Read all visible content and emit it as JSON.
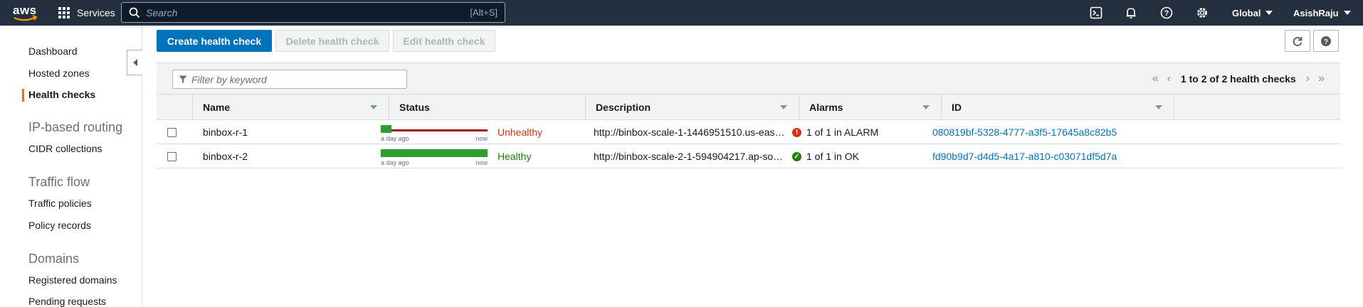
{
  "topnav": {
    "logo_text": "aws",
    "services_label": "Services",
    "search_placeholder": "Search",
    "search_shortcut": "[Alt+S]",
    "region_label": "Global",
    "user_label": "AsishRaju"
  },
  "sidebar": {
    "items": [
      {
        "label": "Dashboard"
      },
      {
        "label": "Hosted zones"
      },
      {
        "label": "Health checks"
      }
    ],
    "sections": [
      {
        "heading": "IP-based routing",
        "items": [
          "CIDR collections"
        ]
      },
      {
        "heading": "Traffic flow",
        "items": [
          "Traffic policies",
          "Policy records"
        ]
      },
      {
        "heading": "Domains",
        "items": [
          "Registered domains",
          "Pending requests"
        ]
      }
    ]
  },
  "toolbar": {
    "create_label": "Create health check",
    "delete_label": "Delete health check",
    "edit_label": "Edit health check"
  },
  "table": {
    "filter_placeholder": "Filter by keyword",
    "pagination_text": "1 to 2 of 2 health checks",
    "columns": [
      "Name",
      "Status",
      "Description",
      "Alarms",
      "ID"
    ],
    "rows": [
      {
        "name": "binbox-r-1",
        "spark_left": "a day ago",
        "spark_right": "now",
        "healthy_fraction": 0.1,
        "status": "Unhealthy",
        "description": "http://binbox-scale-1-1446951510.us-eas…",
        "alarm": "1 of 1 in ALARM",
        "alarm_state": "alarm",
        "id": "080819bf-5328-4777-a3f5-17645a8c82b5"
      },
      {
        "name": "binbox-r-2",
        "spark_left": "a day ago",
        "spark_right": "now",
        "healthy_fraction": 1.0,
        "status": "Healthy",
        "description": "http://binbox-scale-2-1-594904217.ap-so…",
        "alarm": "1 of 1 in OK",
        "alarm_state": "ok",
        "id": "fd90b9d7-d4d5-4a17-a810-c03071df5d7a"
      }
    ]
  },
  "colors": {
    "primary": "#0073bb",
    "healthy": "#1d8102",
    "unhealthy": "#d13212",
    "active_accent": "#ec7211"
  }
}
